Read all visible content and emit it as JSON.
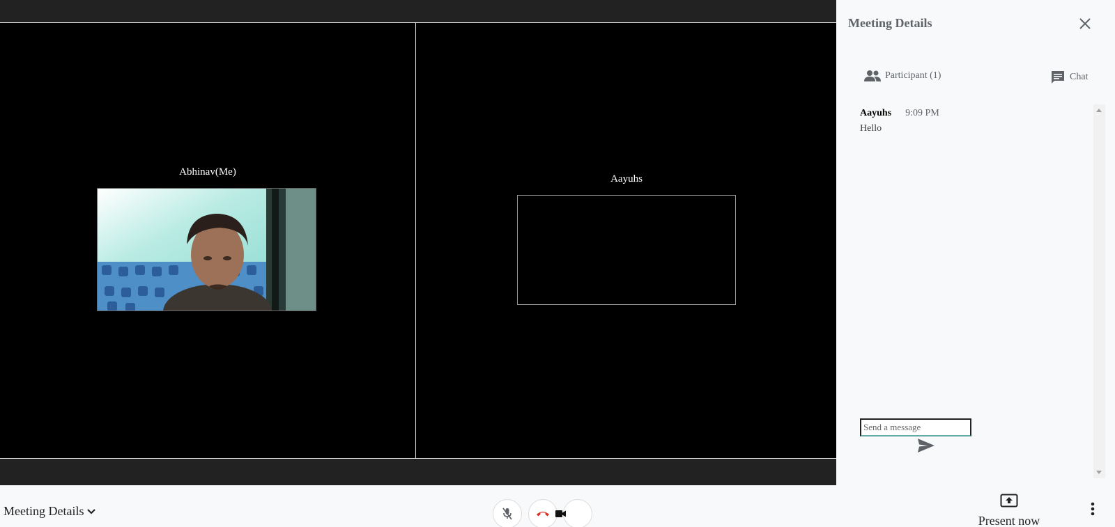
{
  "stage": {
    "left_tile": {
      "name": "Abhinav(Me)"
    },
    "right_tile": {
      "name": "Aayuhs"
    }
  },
  "panel": {
    "title": "Meeting Details",
    "tabs": {
      "participants_label": "Participant (1)",
      "chat_label": "Chat"
    },
    "messages": [
      {
        "sender": "Aayuhs",
        "time": "9:09 PM",
        "text": "Hello"
      }
    ],
    "input_placeholder": "Send a message"
  },
  "footer": {
    "meeting_details_label": "Meeting Details",
    "present_label": "Present now"
  },
  "colors": {
    "hangup_red": "#d93025",
    "dark_bar": "#222222",
    "panel_bg": "#f8f9fa"
  },
  "icons": [
    "mic-off-icon",
    "call-end-icon",
    "videocam-icon",
    "present-icon",
    "more-vert-icon",
    "people-icon",
    "chat-icon",
    "close-icon",
    "send-icon",
    "chevron-down-icon"
  ]
}
